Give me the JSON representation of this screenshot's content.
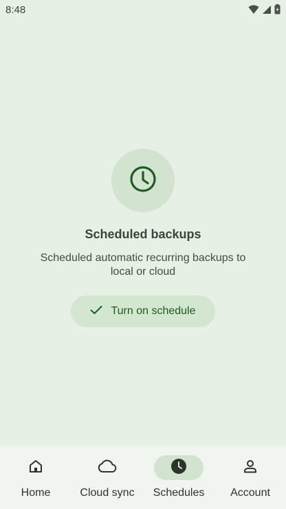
{
  "status_bar": {
    "time": "8:48",
    "icons": [
      "wifi-icon",
      "signal-icon",
      "battery-icon"
    ]
  },
  "empty_state": {
    "icon": "clock-icon",
    "title": "Scheduled backups",
    "subtitle": "Scheduled automatic recurring backups to local or cloud",
    "cta": {
      "icon": "check-icon",
      "label": "Turn on schedule"
    }
  },
  "bottom_nav": {
    "items": [
      {
        "label": "Home",
        "icon": "home-icon",
        "active": false
      },
      {
        "label": "Cloud sync",
        "icon": "cloud-icon",
        "active": false
      },
      {
        "label": "Schedules",
        "icon": "clock-icon",
        "active": true
      },
      {
        "label": "Account",
        "icon": "person-icon",
        "active": false
      }
    ]
  },
  "colors": {
    "background": "#e6f0e4",
    "accent": "#1c5c22",
    "tonal": "#d2e3cf",
    "nav_background": "#f1f5ef"
  }
}
